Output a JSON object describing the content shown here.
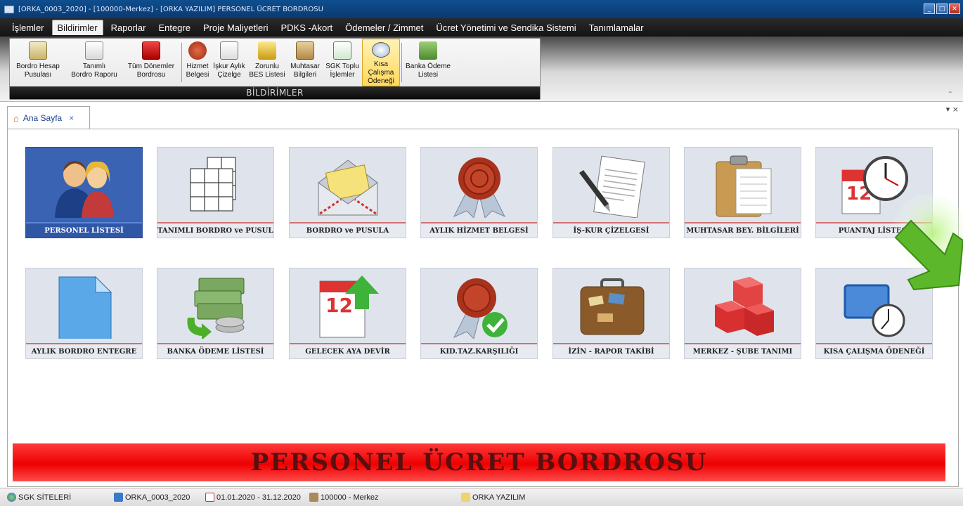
{
  "window": {
    "title": "[ORKA_0003_2020]  -  [100000-Merkez]  -  [ORKA YAZILIM]     PERSONEL ÜCRET BORDROSU"
  },
  "menu": {
    "items": [
      "İşlemler",
      "Bildirimler",
      "Raporlar",
      "Entegre",
      "Proje Maliyetleri",
      "PDKS -Akort",
      "Ödemeler / Zimmet",
      "Ücret Yönetimi ve Sendika Sistemi",
      "Tanımlamalar"
    ],
    "active": "Bildirimler"
  },
  "ribbon": {
    "group_label": "BİLDİRİMLER",
    "buttons": [
      {
        "line1": "Bordro Hesap",
        "line2": "Pusulası",
        "icon": "payslip-icon"
      },
      {
        "line1": "Tanımlı",
        "line2": "Bordro Raporu",
        "icon": "report-icon"
      },
      {
        "line1": "Tüm Dönemler",
        "line2": "Bordrosu",
        "icon": "calendar-icon"
      },
      {
        "line1": "Hizmet",
        "line2": "Belgesi",
        "icon": "seal-icon"
      },
      {
        "line1": "İşkur Aylık",
        "line2": "Çizelge",
        "icon": "contract-icon"
      },
      {
        "line1": "Zorunlu",
        "line2": "BES Listesi",
        "icon": "gold-icon"
      },
      {
        "line1": "Muhtasar",
        "line2": "Bilgileri",
        "icon": "clipboard-icon"
      },
      {
        "line1": "SGK Toplu",
        "line2": "İşlemler",
        "icon": "checklist-icon"
      },
      {
        "line1": "Kısa Çalışma",
        "line2": "Ödeneği",
        "icon": "clock-icon"
      },
      {
        "line1": "Banka Ödeme",
        "line2": "Listesi",
        "icon": "money-icon"
      }
    ]
  },
  "tab": {
    "label": "Ana Sayfa",
    "close": "×"
  },
  "tab_controls": "▾  ×",
  "tiles": [
    {
      "label": "PERSONEL LİSTESİ",
      "icon": "users-icon"
    },
    {
      "label": "TANIMLI BORDRO ve PUSULA",
      "icon": "grid-icon"
    },
    {
      "label": "BORDRO ve PUSULA",
      "icon": "envelope-icon"
    },
    {
      "label": "AYLIK HİZMET BELGESİ",
      "icon": "seal-icon"
    },
    {
      "label": "İŞ-KUR ÇİZELGESİ",
      "icon": "contract-icon"
    },
    {
      "label": "MUHTASAR BEY. BİLGİLERİ",
      "icon": "clipboard-icon"
    },
    {
      "label": "PUANTAJ LİSTESİ",
      "icon": "calendar-clock-icon"
    },
    {
      "label": "AYLIK BORDRO ENTEGRE",
      "icon": "document-icon"
    },
    {
      "label": "BANKA ÖDEME LİSTESİ",
      "icon": "money-icon"
    },
    {
      "label": "GELECEK AYA DEVİR",
      "icon": "calendar-up-icon"
    },
    {
      "label": "KID.TAZ.KARŞILIĞI",
      "icon": "seal-check-icon"
    },
    {
      "label": "İZİN - RAPOR TAKİBİ",
      "icon": "suitcase-icon"
    },
    {
      "label": "MERKEZ - ŞUBE TANIMI",
      "icon": "cubes-icon"
    },
    {
      "label": "KISA ÇALIŞMA ÖDENEĞİ",
      "icon": "screen-clock-icon"
    }
  ],
  "banner": "PERSONEL ÜCRET BORDROSU",
  "status": {
    "items": [
      {
        "text": "SGK SİTELERİ",
        "icon": "globe-icon"
      },
      {
        "text": "ORKA_0003_2020",
        "icon": "book-icon"
      },
      {
        "text": "01.01.2020 - 31.12.2020",
        "icon": "calendar-icon"
      },
      {
        "text": "100000 - Merkez",
        "icon": "building-icon"
      },
      {
        "text": "ORKA YAZILIM",
        "icon": "pen-icon"
      }
    ]
  },
  "colors": {
    "accent_red": "#e00000",
    "tile_blue": "#3a63b4",
    "ribbon_active": "#ffd85a"
  }
}
